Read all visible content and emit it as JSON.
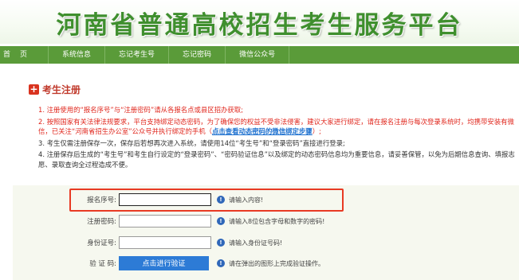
{
  "banner": {
    "title": "河南省普通高校招生考生服务平台"
  },
  "nav": {
    "items": [
      "首页",
      "系统信息",
      "忘记考生号",
      "忘记密码",
      "微信公众号"
    ]
  },
  "section": {
    "title": "考生注册"
  },
  "notes": {
    "n1": "1. 注册使用的“报名序号”与“注册密码”请从各报名点或县区招办获取;",
    "n2a": "2. 按照国家有关法律法规要求，平台支持绑定动态密码，为了确保您的权益不受非法侵害，建议大家进行绑定，请在报名注册与每次登录系统时，均携带安装有微信，已关注“河南省招生办公室”公众号并执行绑定的手机（",
    "n2_link": "点击查看动态密码的微信绑定步骤",
    "n2b": "）;",
    "n3": "3. 考生仅需注册保存一次，保存后若想再次进入系统，请使用14位“考生号”和“登录密码”直接进行登录;",
    "n4": "4. 注册保存后生成的“考生号”和考生自行设定的“登录密码”、“密码验证信息”以及绑定的动态密码信息均为重要信息，请妥善保管，以免为后期信息查询、填报志愿、录取查询全过程造成不便。"
  },
  "form": {
    "reg_no": {
      "label": "报名序号:",
      "value": "",
      "hint": "请输入内容!"
    },
    "reg_pwd": {
      "label": "注册密码:",
      "value": "",
      "hint": "请输入8位包含字母和数字的密码!"
    },
    "id_no": {
      "label": "身份证号:",
      "value": "",
      "hint": "请输入身份证号码!"
    },
    "verify": {
      "label": "验 证 码:",
      "button": "点击进行验证",
      "hint": "请在弹出的图形上完成验证操作。"
    }
  },
  "colors": {
    "brand_green": "#5a9b39",
    "title_green": "#3f8f2e",
    "alert_red": "#e0261c",
    "link_blue": "#1b6fcf",
    "button_blue": "#2d7bd6",
    "highlight_red": "#e83a23"
  },
  "icons": {
    "section": "plus-square-icon",
    "hint": "info-icon"
  }
}
